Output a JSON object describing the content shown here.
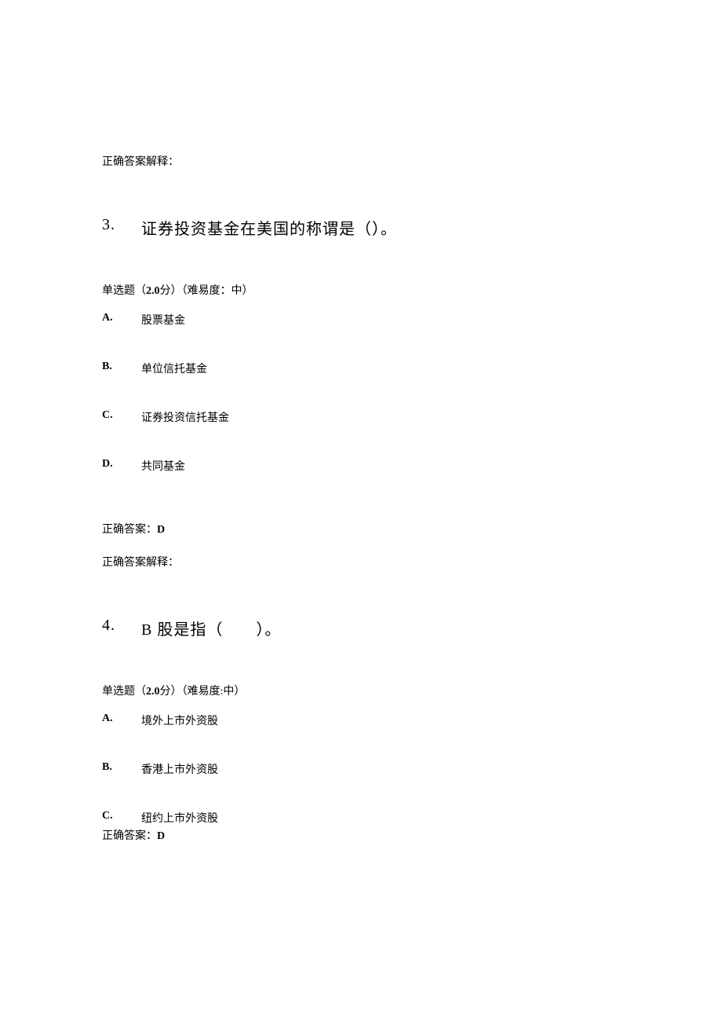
{
  "q2": {
    "explanation_label": "正确答案解释："
  },
  "q3": {
    "number": "3.",
    "title": "证券投资基金在美国的称谓是（）。",
    "meta_prefix": "单选题（",
    "meta_score": "2.0",
    "meta_middle": "分）（难易度：中）",
    "options": {
      "a_letter": "A.",
      "a_text": "股票基金",
      "b_letter": "B.",
      "b_text": "单位信托基金",
      "c_letter": "C.",
      "c_text": "证券投资信托基金",
      "d_letter": "D.",
      "d_text": "共同基金"
    },
    "correct_label": "正确答案：",
    "correct_value": "D",
    "explanation_label": "正确答案解释："
  },
  "q4": {
    "number": "4.",
    "title": "B 股是指（　　）。",
    "meta_prefix": "单选题（",
    "meta_score": "2.0",
    "meta_middle": "分）（难易度:中）",
    "options": {
      "a_letter": "A.",
      "a_text": "境外上市外资股",
      "b_letter": "B.",
      "b_text": "香港上市外资股",
      "c_letter": "C.",
      "c_text": "纽约上市外资股"
    },
    "correct_label": "正确答案：",
    "correct_value": "D"
  }
}
